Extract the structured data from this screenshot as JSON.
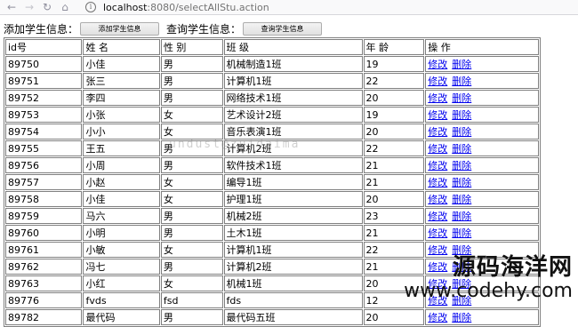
{
  "browser": {
    "url_host": "localhost",
    "url_path": ":8080/selectAllStu.action"
  },
  "actions": {
    "add_label": "添加学生信息：",
    "add_button": "添加学生信息",
    "query_label": "查询学生信息：",
    "query_button": "查询学生信息"
  },
  "table": {
    "headers": [
      "id号",
      "姓 名",
      "性 别",
      "班 级",
      "年 龄",
      "操 作"
    ],
    "edit_label": "修改",
    "delete_label": "删除",
    "rows": [
      [
        "89750",
        "小佳",
        "男",
        "机械制造1班",
        "19"
      ],
      [
        "89751",
        "张三",
        "男",
        "计算机1班",
        "22"
      ],
      [
        "89752",
        "李四",
        "男",
        "网络技术1班",
        "20"
      ],
      [
        "89753",
        "小张",
        "女",
        "艺术设计2班",
        "19"
      ],
      [
        "89754",
        "小小",
        "女",
        "音乐表演1班",
        "20"
      ],
      [
        "89755",
        "王五",
        "男",
        "计算机2班",
        "22"
      ],
      [
        "89756",
        "小周",
        "男",
        "软件技术1班",
        "21"
      ],
      [
        "89757",
        "小赵",
        "女",
        "编导1班",
        "21"
      ],
      [
        "89758",
        "小佳",
        "女",
        "护理1班",
        "20"
      ],
      [
        "89759",
        "马六",
        "男",
        "机械2班",
        "23"
      ],
      [
        "89760",
        "小明",
        "男",
        "土木1班",
        "21"
      ],
      [
        "89761",
        "小敏",
        "女",
        "计算机1班",
        "22"
      ],
      [
        "89762",
        "冯七",
        "男",
        "计算机2班",
        "21"
      ],
      [
        "89763",
        "小红",
        "女",
        "机械1班",
        "20"
      ],
      [
        "89776",
        "fvds",
        "fsd",
        "fds",
        "12"
      ],
      [
        "89782",
        "最代码",
        "男",
        "最代码五班",
        "20"
      ]
    ]
  },
  "watermarks": {
    "middle": "undust@zuidaima",
    "brand": "源码海洋网",
    "site": "www.codehy.com"
  }
}
